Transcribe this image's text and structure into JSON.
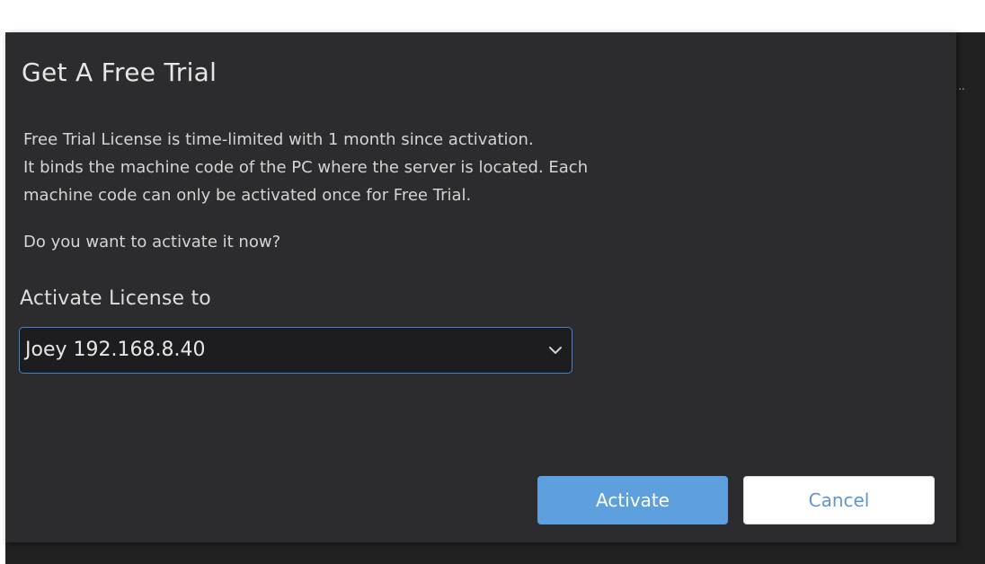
{
  "dialog": {
    "title": "Get A Free Trial",
    "body_lines": [
      "Free Trial License is time-limited with 1 month since activation.",
      "It binds the machine code of the PC where the server is located. Each",
      "machine code can only be activated once for Free Trial."
    ],
    "question": "Do you want to activate it now?",
    "activate_to_label": "Activate License to",
    "selected_device": "Joey 192.168.8.40",
    "activate_label": "Activate",
    "cancel_label": "Cancel"
  },
  "colors": {
    "dialog_bg": "#2c2c2e",
    "accent": "#5ea0dd",
    "select_border": "#3b86d0"
  }
}
